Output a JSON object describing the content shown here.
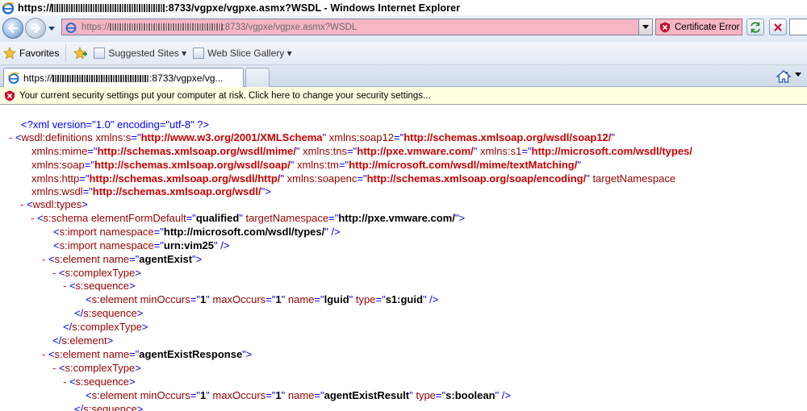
{
  "window": {
    "title_prefix": "https://",
    "title_suffix": ":8733/vgpxe/vgpxe.asmx?WSDL - Windows Internet Explorer"
  },
  "address_bar": {
    "url_prefix": "https://",
    "url_suffix": ":8733/vgpxe/vgpxe.asmx?WSDL",
    "certificate_error_label": "Certificate Error"
  },
  "favorites_bar": {
    "favorites_label": "Favorites",
    "items": [
      {
        "label": "Suggested Sites ▾"
      },
      {
        "label": "Web Slice Gallery ▾"
      }
    ]
  },
  "tabs": [
    {
      "title_prefix": "https://",
      "title_suffix": ":8733/vgpxe/vg..."
    }
  ],
  "info_bar": {
    "message": "Your current security settings put your computer at risk. Click here to change your security settings..."
  },
  "xml": {
    "l1": {
      "text": "<?xml version=\"1.0\" encoding=\"utf-8\" ?>"
    },
    "l2": {
      "open": "<",
      "tag": "wsdl:definitions",
      "a1": "xmlns:s",
      "v1": "http://www.w3.org/2001/XMLSchema",
      "a2": "xmlns:soap12",
      "v2": "http://schemas.xmlsoap.org/wsdl/soap12/"
    },
    "l3": {
      "a1": "xmlns:mime",
      "v1": "http://schemas.xmlsoap.org/wsdl/mime/",
      "a2": "xmlns:tns",
      "v2": "http://pxe.vmware.com/",
      "a3": "xmlns:s1",
      "v3": "http://microsoft.com/wsdl/types/"
    },
    "l4": {
      "a1": "xmlns:soap",
      "v1": "http://schemas.xmlsoap.org/wsdl/soap/",
      "a2": "xmlns:tm",
      "v2": "http://microsoft.com/wsdl/mime/textMatching/"
    },
    "l5": {
      "a1": "xmlns:http",
      "v1": "http://schemas.xmlsoap.org/wsdl/http/",
      "a2": "xmlns:soapenc",
      "v2": "http://schemas.xmlsoap.org/soap/encoding/",
      "a3": "targetNamespace"
    },
    "l6": {
      "a1": "xmlns:wsdl",
      "v1": "http://schemas.xmlsoap.org/wsdl/"
    },
    "l7": {
      "tag": "wsdl:types"
    },
    "l8": {
      "tag": "s:schema",
      "a1": "elementFormDefault",
      "v1": "qualified",
      "a2": "targetNamespace",
      "v2": "http://pxe.vmware.com/"
    },
    "l9": {
      "tag": "s:import",
      "a1": "namespace",
      "v1": "http://microsoft.com/wsdl/types/"
    },
    "l10": {
      "tag": "s:import",
      "a1": "namespace",
      "v1": "urn:vim25"
    },
    "l11": {
      "tag": "s:element",
      "a1": "name",
      "v1": "agentExist"
    },
    "l12": {
      "tag": "s:complexType"
    },
    "l13": {
      "tag": "s:sequence"
    },
    "l14": {
      "tag": "s:element",
      "a1": "minOccurs",
      "v1": "1",
      "a2": "maxOccurs",
      "v2": "1",
      "a3": "name",
      "v3": "lguid",
      "a4": "type",
      "v4": "s1:guid"
    },
    "l15": {
      "tag": "s:sequence"
    },
    "l16": {
      "tag": "s:complexType"
    },
    "l17": {
      "tag": "s:element"
    },
    "l18": {
      "tag": "s:element",
      "a1": "name",
      "v1": "agentExistResponse"
    },
    "l19": {
      "tag": "s:complexType"
    },
    "l20": {
      "tag": "s:sequence"
    },
    "l21": {
      "tag": "s:element",
      "a1": "minOccurs",
      "v1": "1",
      "a2": "maxOccurs",
      "v2": "1",
      "a3": "name",
      "v3": "agentExistResult",
      "a4": "type",
      "v4": "s:boolean"
    },
    "l22": {
      "tag": "s:sequence"
    }
  }
}
